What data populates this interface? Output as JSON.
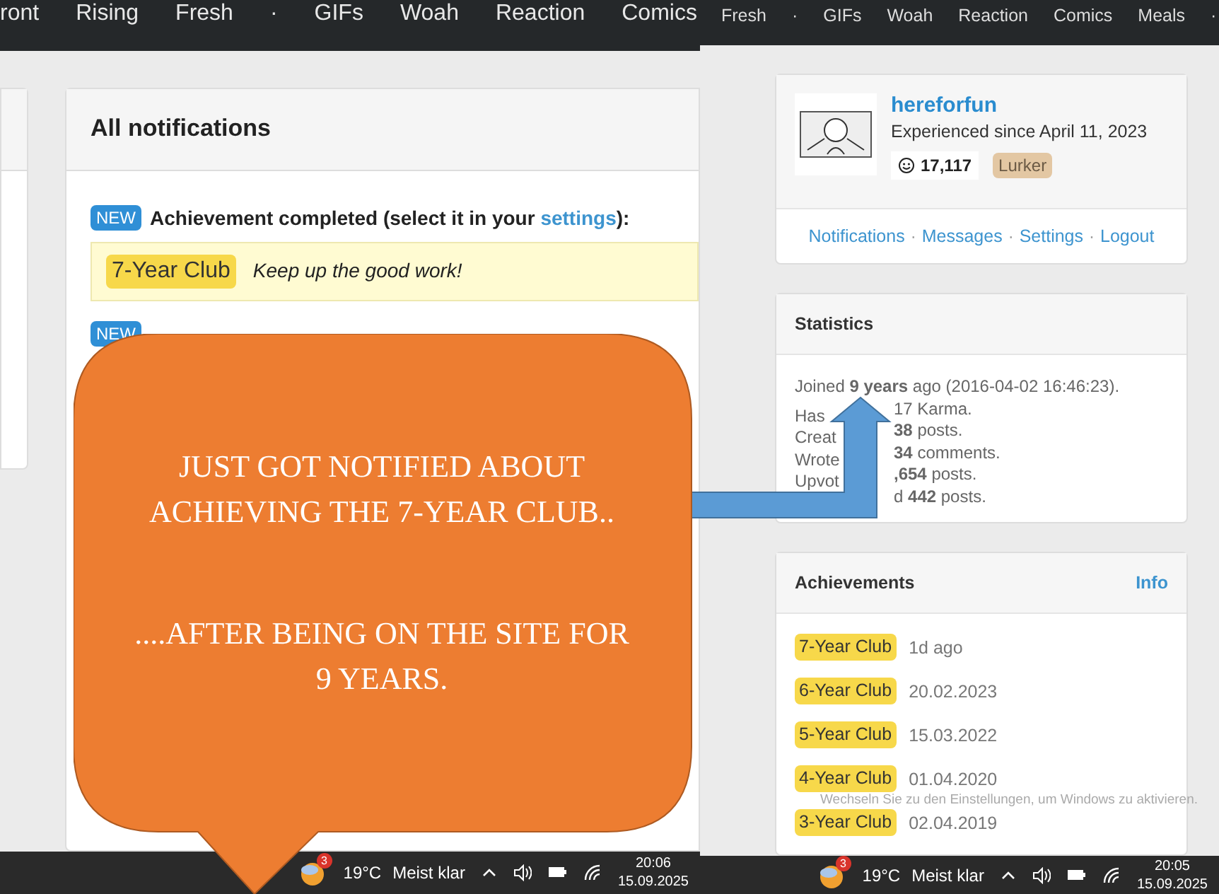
{
  "left_screenshot": {
    "nav": [
      "ront",
      "Rising",
      "Fresh",
      "·",
      "GIFs",
      "Woah",
      "Reaction",
      "Comics"
    ],
    "notifications": {
      "title": "All notifications",
      "items": [
        {
          "badge": "NEW",
          "text": "Achievement completed (select it in your",
          "link": "settings",
          "text_end": "):",
          "achievement": "7-Year Club",
          "message": "Keep up the good work!"
        },
        {
          "badge": "NEW"
        }
      ]
    },
    "taskbar": {
      "weather_badge": "3",
      "temperature": "19°C",
      "weather": "Meist klar",
      "time": "20:06",
      "date": "15.09.2025"
    }
  },
  "right_screenshot": {
    "nav": [
      "Fresh",
      "·",
      "GIFs",
      "Woah",
      "Reaction",
      "Comics",
      "Meals",
      "·"
    ],
    "profile": {
      "username": "hereforfun",
      "rank": "Experienced since April 11, 2023",
      "karma": "17,117",
      "tag": "Lurker",
      "separator": "·",
      "links": [
        "Notifications",
        "Messages",
        "Settings",
        "Logout"
      ]
    },
    "statistics": {
      "title": "Statistics",
      "lines": [
        {
          "left": "Joined **9 years** ago (2016-04-02 16:46:23)."
        },
        {
          "left": "Has",
          "right": "17 Karma."
        },
        {
          "left": "Creat",
          "right": "**38** posts."
        },
        {
          "left": "Wrote",
          "right": "**34** comments."
        },
        {
          "left": "Upvot",
          "right": "**,654** posts."
        },
        {
          "right": "d **442** posts."
        }
      ]
    },
    "achievements": {
      "title": "Achievements",
      "info": "Info",
      "items": [
        {
          "name": "7-Year Club",
          "date": "1d ago"
        },
        {
          "name": "6-Year Club",
          "date": "20.02.2023"
        },
        {
          "name": "5-Year Club",
          "date": "15.03.2022"
        },
        {
          "name": "4-Year Club",
          "date": "01.04.2020"
        },
        {
          "name": "3-Year Club",
          "date": "02.04.2019"
        }
      ]
    },
    "activation_notice": "Wechseln Sie zu den Einstellungen, um Windows zu aktivieren.",
    "taskbar": {
      "weather_badge": "3",
      "temperature": "19°C",
      "weather": "Meist klar",
      "time": "20:05",
      "date": "15.09.2025"
    }
  },
  "speech_bubble": {
    "paragraphs": [
      "JUST GOT NOTIFIED ABOUT ACHIEVING THE 7-YEAR CLUB..",
      "....AFTER BEING ON THE SITE FOR 9 YEARS."
    ]
  }
}
